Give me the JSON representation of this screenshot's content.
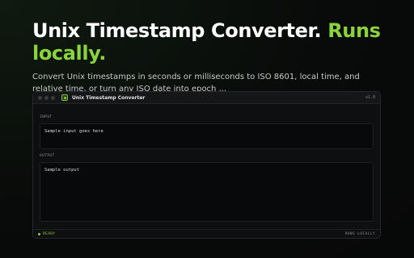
{
  "hero": {
    "headline_main": "Unix Timestamp Converter.",
    "headline_accent": "Runs locally.",
    "subtitle": "Convert Unix timestamps in seconds or milliseconds to ISO 8601, local time, and relative time, or turn any ISO date into epoch ..."
  },
  "window": {
    "title": "Unix Timestamp Converter",
    "version": "v1.0",
    "input": {
      "label": "INPUT",
      "value": "Sample input goes here"
    },
    "output": {
      "label": "OUTPUT",
      "value": "Sample output"
    },
    "status": {
      "left": "READY",
      "right": "RUNS LOCALLY"
    }
  },
  "colors": {
    "accent": "#8bd33a",
    "background": "#090b0a",
    "panel": "#08090a"
  }
}
